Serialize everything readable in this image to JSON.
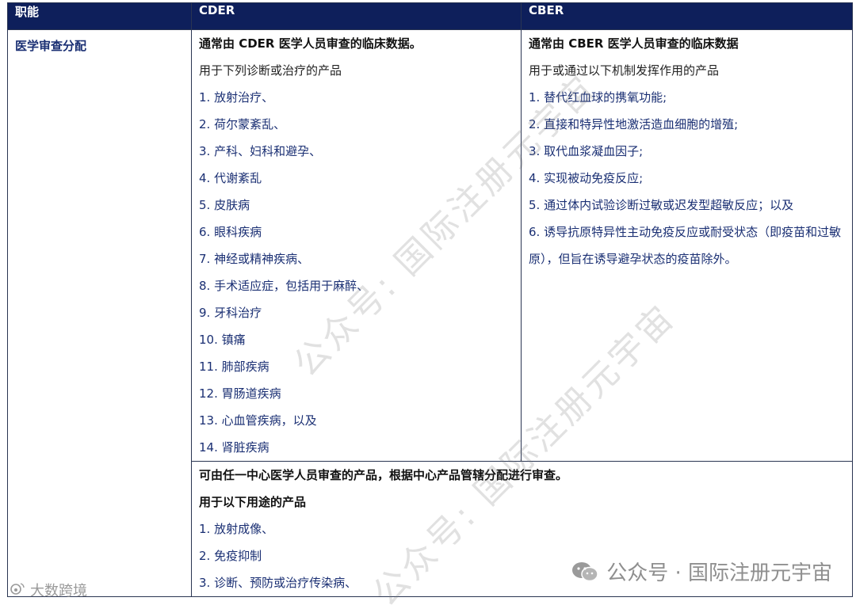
{
  "header": {
    "col1": "职能",
    "col2": "CDER",
    "col3": "CBER"
  },
  "row": {
    "label": "医学审查分配"
  },
  "cder": {
    "title": "通常由 CDER 医学人员审查的临床数据。",
    "intro": "用于下列诊断或治疗的产品",
    "items": [
      "1. 放射治疗、",
      "2. 荷尔蒙紊乱、",
      "3. 产科、妇科和避孕、",
      "4. 代谢紊乱",
      "5. 皮肤病",
      "6. 眼科疾病",
      "7. 神经或精神疾病、",
      "8. 手术适应症，包括用于麻醉、",
      "9. 牙科治疗",
      "10. 镇痛",
      "11. 肺部疾病",
      "12. 胃肠道疾病",
      "13. 心血管疾病，以及",
      "14. 肾脏疾病"
    ]
  },
  "cber": {
    "title": "通常由 CBER 医学人员审查的临床数据",
    "intro": "用于或通过以下机制发挥作用的产品",
    "items": [
      "1. 替代红血球的携氧功能;",
      "2. 直接和特异性地激活造血细胞的增殖;",
      "3. 取代血浆凝血因子;",
      "4. 实现被动免疫反应;",
      "5. 通过体内试验诊断过敏或迟发型超敏反应；以及",
      "6. 诱导抗原特异性主动免疫反应或耐受状态（即疫苗和过敏原），但旨在诱导避孕状态的疫苗除外。"
    ]
  },
  "shared": {
    "title": "可由任一中心医学人员审查的产品，根据中心产品管辖分配进行审查。",
    "intro": "用于以下用途的产品",
    "items": [
      "1. 放射成像、",
      "2. 免疫抑制",
      "3. 诊断、预防或治疗传染病、"
    ]
  },
  "watermarks": {
    "line1": "公众号: 国际注册元宇宙",
    "line2": "公众号: 国际注册元宇宙"
  },
  "footer": {
    "left": "大数跨境",
    "right": "公众号 · 国际注册元宇宙"
  },
  "colors": {
    "header_bg": "#0e1f5b",
    "body_text": "#1a2f73"
  }
}
